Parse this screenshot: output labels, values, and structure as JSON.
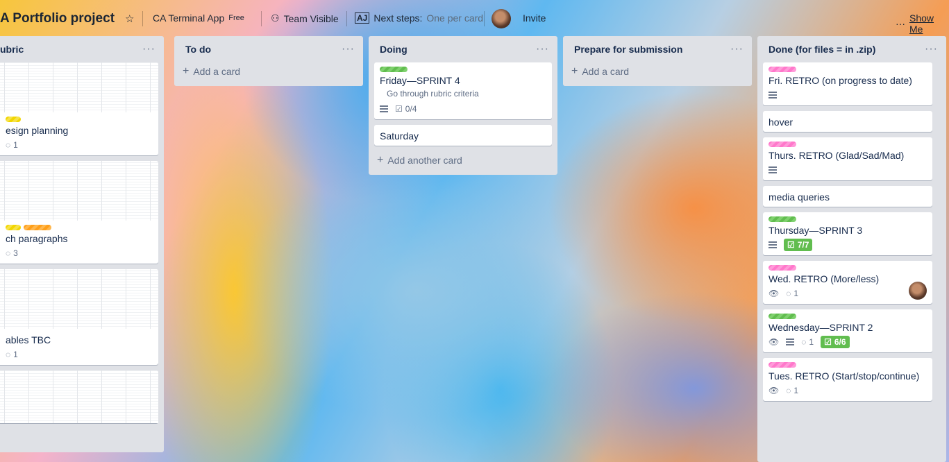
{
  "header": {
    "board_title": "A Portfolio project",
    "star": "☆",
    "workspace": "CA Terminal App",
    "plan": "Free",
    "visibility": "Team Visible",
    "next_steps_label": "Next steps:",
    "next_steps_value": "One per card",
    "invite": "Invite",
    "menu_dots": "···",
    "show_menu": "Show Me"
  },
  "lists": {
    "rubric": {
      "title": "ubric",
      "cards": [
        {
          "title": "esign planning",
          "comments": "1"
        },
        {
          "title": "ch paragraphs",
          "comments": "3"
        },
        {
          "title": "ables TBC",
          "comments": "1"
        }
      ]
    },
    "todo": {
      "title": "To do",
      "add": "Add a card"
    },
    "doing": {
      "title": "Doing",
      "cards": [
        {
          "title": "Friday—SPRINT 4",
          "subitem": "Go through rubric criteria",
          "checklist": "0/4"
        },
        {
          "title": "Saturday"
        }
      ],
      "add": "Add another card"
    },
    "prepare": {
      "title": "Prepare for submission",
      "add": "Add a card"
    },
    "done": {
      "title": "Done (for files = in .zip)",
      "cards": [
        {
          "title": "Fri. RETRO (on progress to date)"
        },
        {
          "title": "hover"
        },
        {
          "title": "Thurs. RETRO (Glad/Sad/Mad)"
        },
        {
          "title": "media queries"
        },
        {
          "title": "Thursday—SPRINT 3",
          "checklist": "7/7"
        },
        {
          "title": "Wed. RETRO (More/less)",
          "comments": "1"
        },
        {
          "title": "Wednesday—SPRINT 2",
          "comments": "1",
          "checklist": "6/6"
        },
        {
          "title": "Tues. RETRO (Start/stop/continue)",
          "comments": "1"
        }
      ]
    }
  },
  "colors": {
    "label_green": "#61bd4f",
    "label_pink": "#ff78cb",
    "label_yellow": "#f2d600",
    "label_orange": "#ff9f1a",
    "list_bg": "#dfe1e6"
  }
}
